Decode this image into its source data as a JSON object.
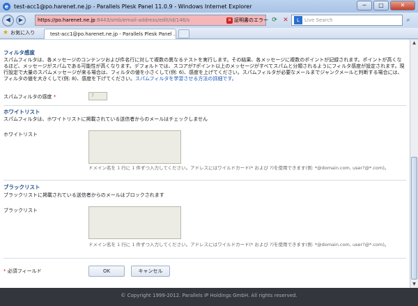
{
  "window": {
    "title": "test-acc1@po.harenet.ne.jp - Parallels Plesk Panel 11.0.9 - Windows Internet Explorer",
    "minimize": "─",
    "maximize": "□",
    "close": "✕"
  },
  "address": {
    "host": "https://po.harenet.ne.jp",
    "path": ":8443/smb/email-address/edit/id/146/s",
    "cert_error": "証明書のエラー"
  },
  "search": {
    "placeholder": "Live Search"
  },
  "favorites": {
    "label": "お気に入り"
  },
  "tab": {
    "label": "test-acc1@po.harenet.ne.jp - Parallels Plesk Panel ..."
  },
  "filter": {
    "title": "フィルタ感度",
    "description": "スパムフィルタは、各メッセージのコンテンツおよび件名行に対して複数の異なるテストを実行します。その結果、各メッセージに複数のポイントが記録されます。ポイントが高くなるほど、メッセージがスパムである可能性が高くなります。デフォルトでは、スコアが7ポイント以上のメッセージがすべてスパムと分類されるようにフィルタ感度が設定されます。現行設定で大量のスパムメッセージが来る場合は、フィルタの値を小さくして(例: 6)、感度を上げてください。スパムフィルタが必要なメールまでジャンクメールと判断する場合には、フィルタの値を大きくして(例: 8)、感度を下げてください。",
    "link": "スパムフィルタを学習させる方法の詳細です。",
    "sensitivity_label": "スパムフィルタの感度",
    "sensitivity_value": "7"
  },
  "whitelist": {
    "title": "ホワイトリスト",
    "description": "スパムフィルタは、ホワイトリストに掲載されている送信者からのメールはチェックしません",
    "label": "ホワイトリスト",
    "hint": "ドメイン名を 1 行に 1 件ずつ入力してください。アドレスにはワイルドカード(* および ?)を使用できます(例: *@domain.com, user?@*.com)。"
  },
  "blacklist": {
    "title": "ブラックリスト",
    "description": "ブラックリストに掲載されている送信者からのメールはブロックされます",
    "label": "ブラックリスト",
    "hint": "ドメイン名を 1 行に 1 件ずつ入力してください。アドレスにはワイルドカード(* および ?)を使用できます(例: *@domain.com, user?@*.com)。"
  },
  "form": {
    "required_note": "必須フィールド",
    "required_mark": "*",
    "ok_label": "OK",
    "cancel_label": "キャンセル"
  },
  "footer": {
    "copyright": "© Copyright 1999-2012. Parallels IP Holdings GmbH. All rights reserved."
  }
}
